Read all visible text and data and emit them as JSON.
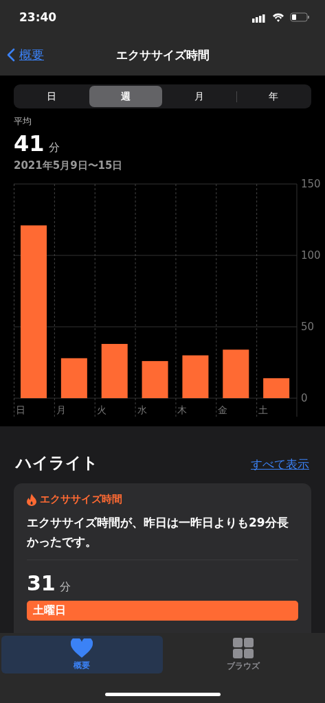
{
  "status_bar": {
    "time": "23:40"
  },
  "nav": {
    "back": "概要",
    "title": "エクササイズ時間"
  },
  "segments": [
    {
      "label": "日",
      "selected": false
    },
    {
      "label": "週",
      "selected": true
    },
    {
      "label": "月",
      "selected": false
    },
    {
      "label": "年",
      "selected": false
    }
  ],
  "summary": {
    "label": "平均",
    "value": "41",
    "unit": "分",
    "range": "2021年5月9日〜15日"
  },
  "chart_data": {
    "type": "bar",
    "categories": [
      "日",
      "月",
      "火",
      "水",
      "木",
      "金",
      "土"
    ],
    "series": [
      {
        "color": "#ff6a33",
        "values": [
          121,
          28,
          38,
          26,
          30,
          34,
          14
        ]
      }
    ],
    "ylim": [
      0,
      150
    ],
    "yticks": [
      0,
      50,
      100,
      150
    ]
  },
  "highlights": {
    "title": "ハイライト",
    "show_all": "すべて表示",
    "card": {
      "category": "エクササイズ時間",
      "text": "エクササイズ時間が、昨日は一昨日よりも29分長かったです。",
      "value": "31",
      "unit": "分",
      "bar_label": "土曜日"
    }
  },
  "tab_bar": [
    {
      "label": "概要",
      "kind": "heart",
      "selected": true
    },
    {
      "label": "ブラウズ",
      "kind": "grid",
      "selected": false
    }
  ]
}
